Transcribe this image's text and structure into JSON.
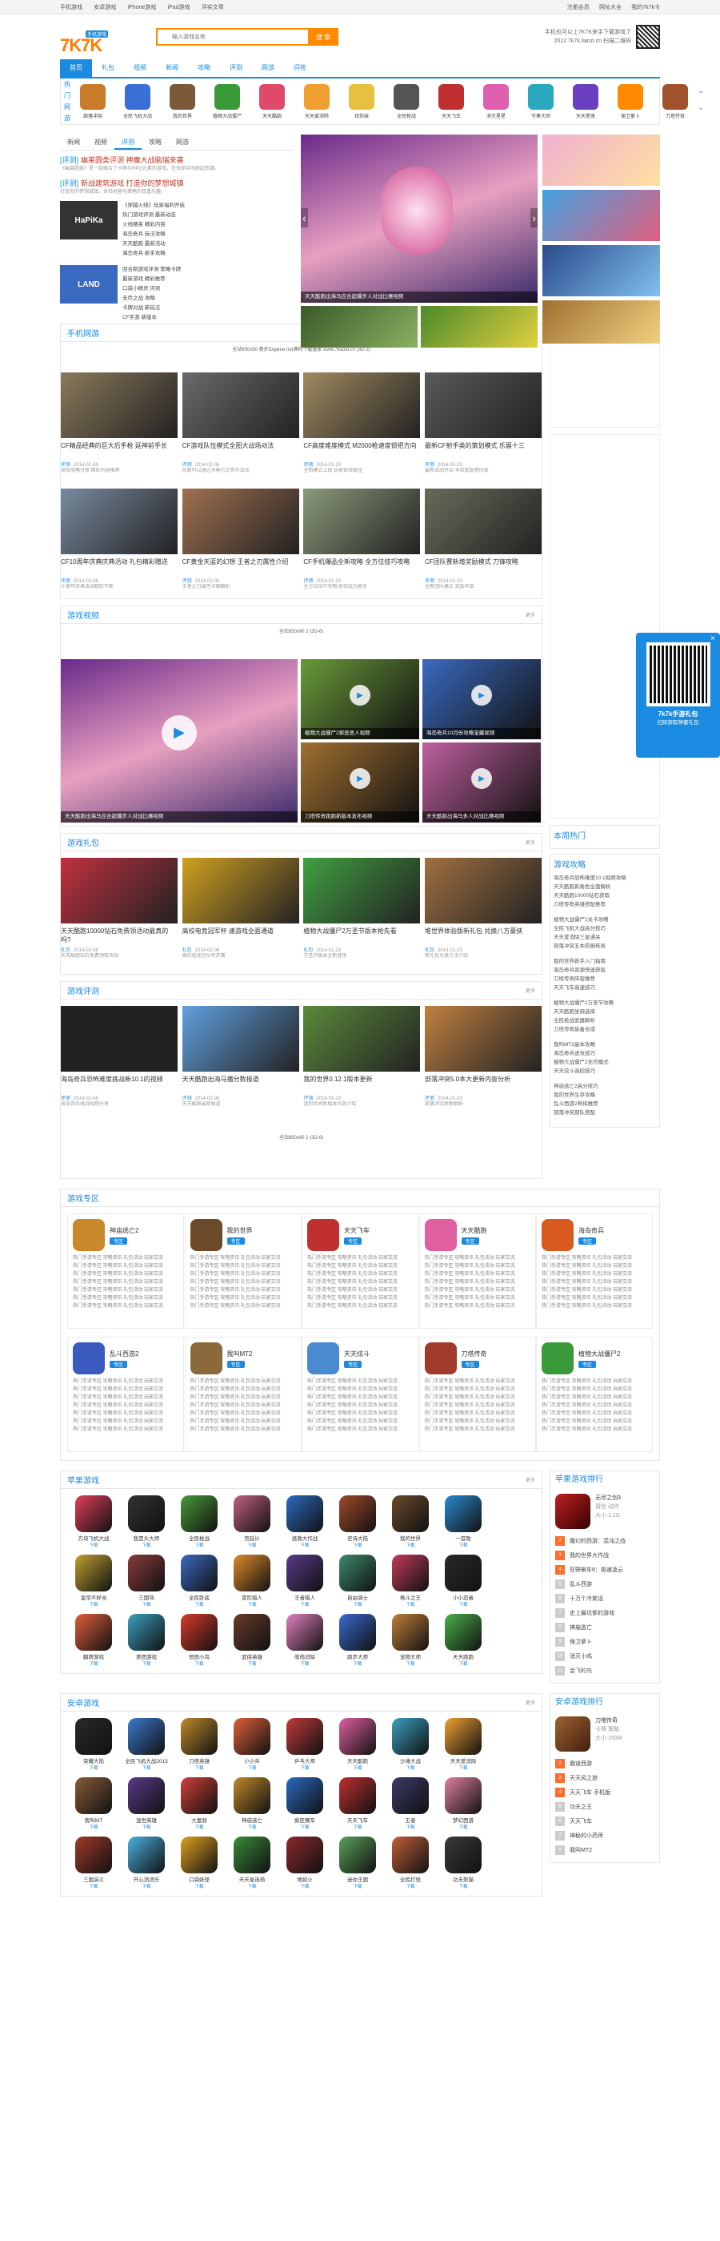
{
  "topbar": {
    "left": [
      "手机游戏",
      "安卓游戏",
      "iPhone游戏",
      "iPad游戏",
      "评实文章"
    ],
    "right": [
      "注册会员",
      "网址大全",
      "我的7k7k卡"
    ]
  },
  "header": {
    "logo_main": "7K7K",
    "logo_sub": "手机游戏",
    "search_placeholder": "输入游戏名称",
    "search_button": "搜 索",
    "right_line1": "手机也可以上7K7K来手下载游戏了",
    "right_line2": "2012 7k7k.lianzi.cn 扫描二维码"
  },
  "nav": [
    "首页",
    "礼包",
    "视频",
    "新闻",
    "攻略",
    "评测",
    "网游",
    "问答"
  ],
  "gamebar": {
    "label_lines": [
      "热门",
      "网游"
    ],
    "games": [
      {
        "name": "部落冲突",
        "color": "#c97b2a"
      },
      {
        "name": "全民飞机大战",
        "color": "#3a6fd8"
      },
      {
        "name": "我的世界",
        "color": "#7b5a3a"
      },
      {
        "name": "植物大战僵尸",
        "color": "#3a9a3a"
      },
      {
        "name": "天天酷跑",
        "color": "#e04a6a"
      },
      {
        "name": "天天爱消除",
        "color": "#f0a030"
      },
      {
        "name": "找你妹",
        "color": "#e8c040"
      },
      {
        "name": "全民枪战",
        "color": "#555"
      },
      {
        "name": "天天飞车",
        "color": "#c03030"
      },
      {
        "name": "消灭星星",
        "color": "#e060b0"
      },
      {
        "name": "节奏大师",
        "color": "#2aa8c0"
      },
      {
        "name": "天天星座",
        "color": "#6a40c0"
      },
      {
        "name": "保卫萝卜",
        "color": "#ff8a00"
      },
      {
        "name": "刀塔传奇",
        "color": "#a0522d"
      }
    ]
  },
  "news": {
    "tabs": [
      "新闻",
      "视频",
      "评测",
      "攻略",
      "网游"
    ],
    "active_tab": 2,
    "items": [
      {
        "tag": "[评测]",
        "title": "幽莱圆类评测 神魔大战脑瑞来袭",
        "desc": "《幽莱圆类》是一款融合了卡牌与RPG元素的游戏，在玩家中间掀起热潮。"
      },
      {
        "tag": "[评测]",
        "title": "新战建筑游戏 打造你的梦想城镇",
        "desc": "打造你的梦想城镇，体验经营与策略的双重乐趣。"
      }
    ],
    "thumbs": [
      {
        "label": "HaPiKa",
        "lines": [
          "《穿越火线》玩家福利开启",
          "热门游戏评测 最新动态",
          "火线精英 精彩内容",
          "海岛奇兵 玩法攻略",
          "天天酷跑 最新活动",
          "海岛奇兵 新手攻略"
        ]
      },
      {
        "label": "LAND",
        "lines": [
          "回合制游戏评测 策略卡牌",
          "最新游戏 精彩推荐",
          "口袋小精灵 评测",
          "无尽之战 攻略",
          "卡牌对战 新玩法",
          "CF手游 新版本"
        ]
      }
    ]
  },
  "hero": {
    "main_caption": "天天酷跑出海马应合超爆步人对战比赛视频"
  },
  "mobile": {
    "title": "手机网游",
    "more": "更多",
    "ad": "全站950x90 豪步iDgame.net满科下载届素 www.7kaoid.cn (3D-3)",
    "cards": [
      {
        "title": "CF精品经典的巨大后手枪 延神前手长",
        "cat": "评测",
        "date": "2014-02-06",
        "desc": "游戏攻略分享 精彩内容推荐"
      },
      {
        "title": "CF游戏队伍模式全图大战场动法",
        "cat": "评测",
        "date": "2014-02-05",
        "desc": "玩家可以通过多种方式参与活动"
      },
      {
        "title": "CF高度难度模式 M2000枪速度锁把方向",
        "cat": "评测",
        "date": "2014-01-23",
        "desc": "全新模式上线 玩家体验极佳"
      },
      {
        "title": "最新CF射手类的策划模式 乐展十三",
        "cat": "评测",
        "date": "2014-01-23",
        "desc": "最新活动开启 丰厚奖励等你拿"
      },
      {
        "title": "CF10周年庆典庆典活动 礼包精彩赠送",
        "cat": "评测",
        "date": "2014-02-06",
        "desc": "十周年庆典活动精彩不断"
      },
      {
        "title": "CF黄金天蓝的幻想 王者之刃属性介绍",
        "cat": "评测",
        "date": "2014-02-05",
        "desc": "王者之刃属性详细解析"
      },
      {
        "title": "CF手机爆品全新攻略 全方位技巧攻略",
        "cat": "评测",
        "date": "2014-01-23",
        "desc": "全方位技巧攻略 助你成为高手"
      },
      {
        "title": "CF团队赛新增奖励模式 刀锋攻略",
        "cat": "评测",
        "date": "2014-01-23",
        "desc": "全新团队模式 奖励丰厚"
      }
    ]
  },
  "video": {
    "title": "游戏视频",
    "more": "更多",
    "ad": "全站950x90 2 (3D-6)",
    "main_caption": "天天酷跑出海马应合超爆步人对战比赛视频",
    "small": [
      "植物大战僵尸2邪恶恶人视频",
      "海岛奇兵10月份攻略宝藏视频",
      "刀塔传奇跑跑新版本发布视频",
      "天天酷跑出海马多人对战比赛视频"
    ]
  },
  "gifts": {
    "title": "游戏礼包",
    "more": "更多",
    "cards": [
      {
        "title": "天天酷跑10000钻石免费领活动最真的吗?",
        "cat": "礼包",
        "date": "2014-02-06",
        "desc": "天天酷跑钻石免费领取活动"
      },
      {
        "title": "高校电竞冠军杯 速游戏全面通道",
        "cat": "礼包",
        "date": "2014-02-06",
        "desc": "高校电竞冠军杯开赛"
      },
      {
        "title": "植物大战僵尸2万圣节版本抢先看",
        "cat": "礼包",
        "date": "2014-01-23",
        "desc": "万圣节版本全新登场"
      },
      {
        "title": "堆世界体验版新礼包 兑换八方豪侠",
        "cat": "礼包",
        "date": "2014-01-23",
        "desc": "新礼包兑换方法介绍"
      }
    ]
  },
  "reviews": {
    "title": "游戏评测",
    "more": "更多",
    "ad": "全站950x90 2 (3D-6)",
    "cards": [
      {
        "title": "海岛奇兵恐怖难度挑战新10.1的视频",
        "cat": "评测",
        "date": "2014-02-06",
        "desc": "海岛奇兵挑战视频分享"
      },
      {
        "title": "天天酷跑出海马播分数报道",
        "cat": "评测",
        "date": "2014-02-06",
        "desc": "天天酷跑最新报道"
      },
      {
        "title": "我的世界0.12.1版本更新",
        "cat": "评测",
        "date": "2014-01-23",
        "desc": "我的世界新版本内容介绍"
      },
      {
        "title": "部落冲突5.0本大更新内容分析",
        "cat": "评测",
        "date": "2014-01-23",
        "desc": "部落冲突更新解析"
      }
    ]
  },
  "zone": {
    "title": "游戏专区",
    "badge": "专区",
    "apps": [
      {
        "name": "神庙逃亡2",
        "color": "#c9882a"
      },
      {
        "name": "我的世界",
        "color": "#6b4a2a"
      },
      {
        "name": "天天飞车",
        "color": "#c03030"
      },
      {
        "name": "天天酷跑",
        "color": "#e060a0"
      },
      {
        "name": "海岛奇兵",
        "color": "#d85a20"
      },
      {
        "name": "乱斗西游2",
        "color": "#3a5ac0"
      },
      {
        "name": "我叫MT2",
        "color": "#8a6a3a"
      },
      {
        "name": "天天炫斗",
        "color": "#4a8ad0"
      },
      {
        "name": "刀塔传奇",
        "color": "#a03a2a"
      },
      {
        "name": "植物大战僵尸2",
        "color": "#3a9a3a"
      }
    ],
    "desc": "热门手游专区 攻略资讯 礼包活动 玩家交流"
  },
  "apple": {
    "title": "苹果游戏",
    "more": "更多",
    "btn": "下载",
    "games": [
      {
        "name": "方块飞机大战",
        "color": "#e0405a"
      },
      {
        "name": "我是头大师",
        "color": "#333"
      },
      {
        "name": "全民枪战",
        "color": "#4a9a3a"
      },
      {
        "name": "宫廷计",
        "color": "#c06080"
      },
      {
        "name": "拯救大作战",
        "color": "#2a6ac0"
      },
      {
        "name": "史诗大陆",
        "color": "#a04a2a"
      },
      {
        "name": "我的世界",
        "color": "#6a4a2a"
      },
      {
        "name": "一首歌",
        "color": "#2a8ad0"
      },
      {
        "name": "皇帝不好当",
        "color": "#c0a030"
      },
      {
        "name": "三国驾",
        "color": "#8a3a3a"
      },
      {
        "name": "全民卧底",
        "color": "#3a6ac0"
      },
      {
        "name": "冒险猎人",
        "color": "#e08a2a"
      },
      {
        "name": "王者猎人",
        "color": "#5a3a8a"
      },
      {
        "name": "自由骑士",
        "color": "#3a8a6a"
      },
      {
        "name": "格斗之王",
        "color": "#c03a5a"
      },
      {
        "name": "小小忍者",
        "color": "#2a2a2a"
      },
      {
        "name": "翻牌游戏",
        "color": "#e0603a"
      },
      {
        "name": "美团游戏",
        "color": "#3aa0c0"
      },
      {
        "name": "愤怒小鸟",
        "color": "#d83a2a"
      },
      {
        "name": "武侠英雄",
        "color": "#6a3a2a"
      },
      {
        "name": "萌萌消除",
        "color": "#e080c0"
      },
      {
        "name": "跑步大师",
        "color": "#3a6ad0"
      },
      {
        "name": "宠物大师",
        "color": "#c0803a"
      },
      {
        "name": "天天跑跑",
        "color": "#4ab04a"
      }
    ]
  },
  "android": {
    "title": "安卓游戏",
    "more": "更多",
    "btn": "下载",
    "games": [
      {
        "name": "荣耀大陆",
        "color": "#2a2a2a"
      },
      {
        "name": "全民飞机大战2015",
        "color": "#3a7ad0"
      },
      {
        "name": "刀塔英雄",
        "color": "#c08a2a"
      },
      {
        "name": "小小兵",
        "color": "#e0603a"
      },
      {
        "name": "乒乓大师",
        "color": "#c03a3a"
      },
      {
        "name": "天天酷跑",
        "color": "#e060a0"
      },
      {
        "name": "沙滩大战",
        "color": "#3aa0c0"
      },
      {
        "name": "天天爱消除",
        "color": "#f0a030"
      },
      {
        "name": "我叫MT",
        "color": "#8a5a3a"
      },
      {
        "name": "混世英雄",
        "color": "#5a3a8a"
      },
      {
        "name": "大富翁",
        "color": "#d0403a"
      },
      {
        "name": "神庙逃亡",
        "color": "#c0882a"
      },
      {
        "name": "疯狂赛车",
        "color": "#2a6ac0"
      },
      {
        "name": "天天飞车",
        "color": "#c03030"
      },
      {
        "name": "王者",
        "color": "#3a3a6a"
      },
      {
        "name": "梦幻西游",
        "color": "#e080a0"
      },
      {
        "name": "三国演义",
        "color": "#a03a2a"
      },
      {
        "name": "开心消消乐",
        "color": "#4ab0e0"
      },
      {
        "name": "口袋妖怪",
        "color": "#e0a020"
      },
      {
        "name": "天天星连萌",
        "color": "#3a8a3a"
      },
      {
        "name": "地狱火",
        "color": "#8a2a2a"
      },
      {
        "name": "迷你王国",
        "color": "#5aa05a"
      },
      {
        "name": "全民打怪",
        "color": "#c0603a"
      },
      {
        "name": "功夫熊猫",
        "color": "#3a3a3a"
      }
    ]
  },
  "sidebar": {
    "hot_title": "本周热门",
    "strategy_title": "游戏攻略",
    "strategy_items": [
      "海岛奇兵恐怖难度10 1视频攻略",
      "天天酷跑新角色全面解析",
      "天天酷跑10000钻石获取",
      "刀塔传奇英雄搭配推荐",
      "植物大战僵尸2关卡攻略",
      "全民飞机大战高分技巧",
      "天天爱消除三星通关",
      "部落冲突五本防御布局",
      "我的世界新手入门指南",
      "海岛奇兵资源快速获取",
      "刀塔传奇阵容推荐",
      "天天飞车高速技巧",
      "植物大战僵尸2万圣节攻略",
      "天天酷跑坐骑选择",
      "全民枪战武器解析",
      "刀塔传奇装备合成",
      "我叫MT2副本攻略",
      "海岛奇兵进攻技巧",
      "植物大战僵尸2无尽模式",
      "天天炫斗连招技巧",
      "神庙逃亡2高分技巧",
      "我的世界生存攻略",
      "乱斗西游2神将推荐",
      "部落冲突部队搭配"
    ],
    "apple_rank_title": "苹果游戏排行",
    "apple_rank_top": {
      "name": "无尽之剑3",
      "line1": "冒险 动作",
      "line2": "大小:1.2G"
    },
    "apple_rank": [
      "魔幻的西游：混沌之战",
      "我的世界大作战",
      "狂野飙车8：极速凌云",
      "乱斗西游",
      "十万个冷笑话",
      "史上最坑爹的游戏",
      "神庙逃亡",
      "保卫萝卜",
      "消灭小鸡",
      "会飞的鸟"
    ],
    "android_rank_title": "安卓游戏排行",
    "android_rank_top": {
      "name": "刀塔传奇",
      "line1": "卡牌 策略",
      "line2": "大小:150M"
    },
    "android_rank": [
      "霸道西游",
      "天天风之旅",
      "天天飞车 手机版",
      "功夫之王",
      "天天飞车",
      "神秘的小药师",
      "我叫MT2"
    ]
  },
  "floatad": {
    "text1": "7k7k手游礼包",
    "text2": "扫码获取神豪礼包"
  }
}
